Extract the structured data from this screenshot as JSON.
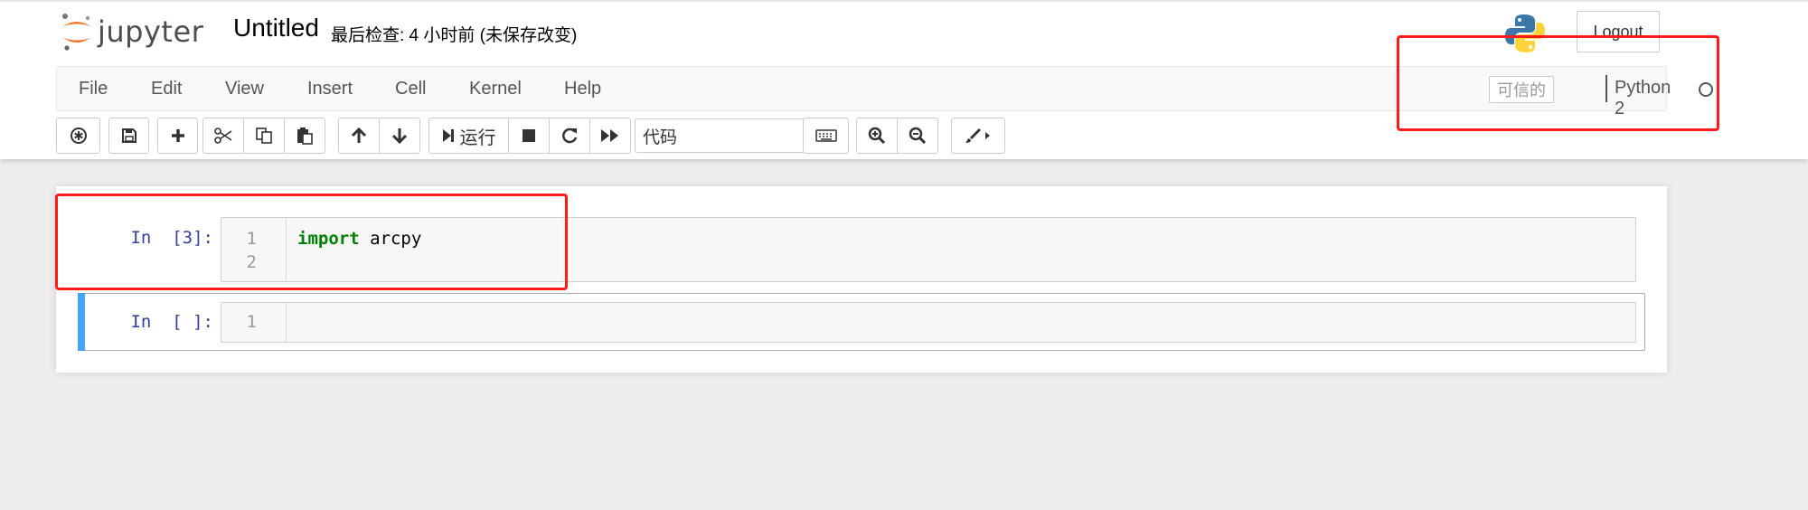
{
  "header": {
    "logo_text": "jupyter",
    "notebook_name": "Untitled",
    "checkpoint_status": "最后检查: 4 小时前  (未保存改变)",
    "logout_label": "Logout"
  },
  "menubar": {
    "items": [
      "File",
      "Edit",
      "View",
      "Insert",
      "Cell",
      "Kernel",
      "Help"
    ],
    "trusted_label": "可信的",
    "kernel_name": "Python 2"
  },
  "toolbar": {
    "run_label": "运行",
    "cell_type": "代码",
    "icons": [
      "command-palette-icon",
      "save-icon",
      "add-cell-icon",
      "cut-icon",
      "copy-icon",
      "paste-icon",
      "move-up-icon",
      "move-down-icon",
      "run-icon",
      "stop-icon",
      "restart-icon",
      "fast-forward-icon",
      "keyboard-icon",
      "zoom-in-icon",
      "zoom-out-icon",
      "paint-brush-icon"
    ]
  },
  "cells": [
    {
      "prompt": "In  [3]:",
      "line_numbers": [
        "1",
        "2"
      ],
      "code_keyword": "import",
      "code_rest": " arcpy"
    },
    {
      "prompt": "In  [ ]:",
      "line_numbers": [
        "1"
      ]
    }
  ],
  "colors": {
    "prompt": "#303f9f",
    "keyword": "#008000",
    "selected_cell_bar": "#42a5f5",
    "annotation": "#ff1a1a",
    "jupyter_orange": "#f37726"
  }
}
